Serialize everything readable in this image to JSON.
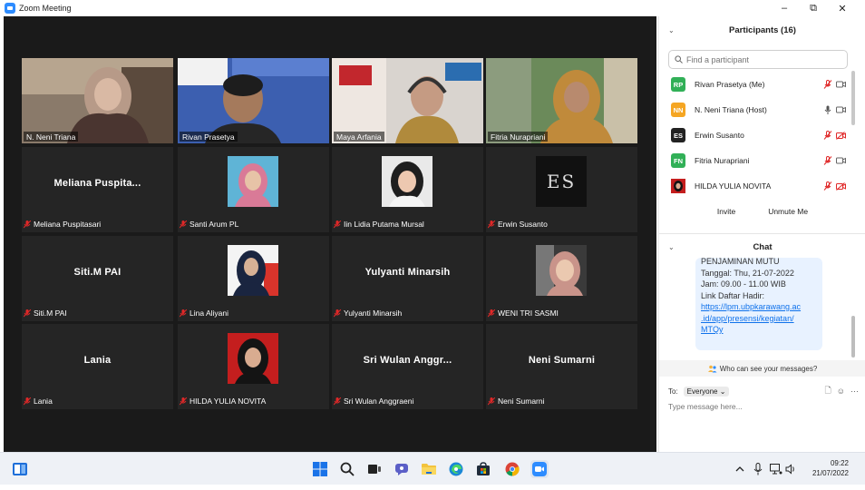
{
  "window": {
    "title": "Zoom Meeting",
    "minimize": "–",
    "restore": "⧉",
    "close": "✕"
  },
  "tiles": [
    {
      "name": "N. Neni Triana",
      "muted": false,
      "active": true
    },
    {
      "name": "Rivan Prasetya",
      "muted": false
    },
    {
      "name": "Maya Arfania",
      "muted": false
    },
    {
      "name": "Fitria Nurapriani",
      "muted": false
    },
    {
      "name": "Meliana Puspitasari",
      "display": "Meliana  Puspita...",
      "muted": true
    },
    {
      "name": "Santi Arum PL",
      "muted": true
    },
    {
      "name": "Iin Lidia Putama Mursal",
      "muted": true
    },
    {
      "name": "Erwin Susanto",
      "muted": true
    },
    {
      "name": "Siti.M  PAI",
      "display": "Siti.M  PAI",
      "muted": true
    },
    {
      "name": "Lina Aliyani",
      "muted": true
    },
    {
      "name": "Yulyanti Minarsih",
      "display": "Yulyanti Minarsih",
      "muted": true
    },
    {
      "name": "WENI TRI SASMI",
      "muted": true
    },
    {
      "name": "Lania",
      "display": "Lania",
      "muted": true
    },
    {
      "name": "HILDA YULIA NOVITA",
      "muted": true
    },
    {
      "name": "Sri Wulan Anggraeni",
      "display": "Sri Wulan Anggr...",
      "muted": true
    },
    {
      "name": "Neni Sumarni",
      "display": "Neni Sumarni",
      "muted": true
    }
  ],
  "erwin_logo": "ES",
  "participants": {
    "title": "Participants (16)",
    "search_placeholder": "Find a participant",
    "list": [
      {
        "initials": "RP",
        "name": "Rivan Prasetya (Me)",
        "color": "#31b057"
      },
      {
        "initials": "NN",
        "name": "N. Neni Triana (Host)",
        "color": "#f5a623"
      },
      {
        "initials": "ES",
        "name": "Erwin Susanto",
        "color": "#222222"
      },
      {
        "initials": "FN",
        "name": "Fitria Nurapriani",
        "color": "#31b057"
      },
      {
        "initials": "",
        "name": "HILDA YULIA NOVITA",
        "color": "#7a1d1d"
      }
    ],
    "invite": "Invite",
    "unmute_me": "Unmute Me"
  },
  "chat": {
    "title": "Chat",
    "lines": [
      "PENJAMINAN MUTU",
      "Tanggal: Thu, 21-07-2022",
      "Jam: 09.00 - 11.00 WIB",
      "Link Daftar Hadir:"
    ],
    "link_lines": [
      "https://lpm.ubpkarawang.ac",
      ".id/app/presensi/kegiatan/",
      "MTQy"
    ],
    "who_can_see": "Who can see your messages?",
    "to_label": "To:",
    "to_value": "Everyone",
    "message_placeholder": "Type message here..."
  },
  "taskbar": {
    "time": "09:22",
    "date": "21/07/2022"
  },
  "colors": {
    "zoom_blue": "#2d8cff",
    "active_speaker": "#c7e45a",
    "muted_red": "#e02828"
  }
}
